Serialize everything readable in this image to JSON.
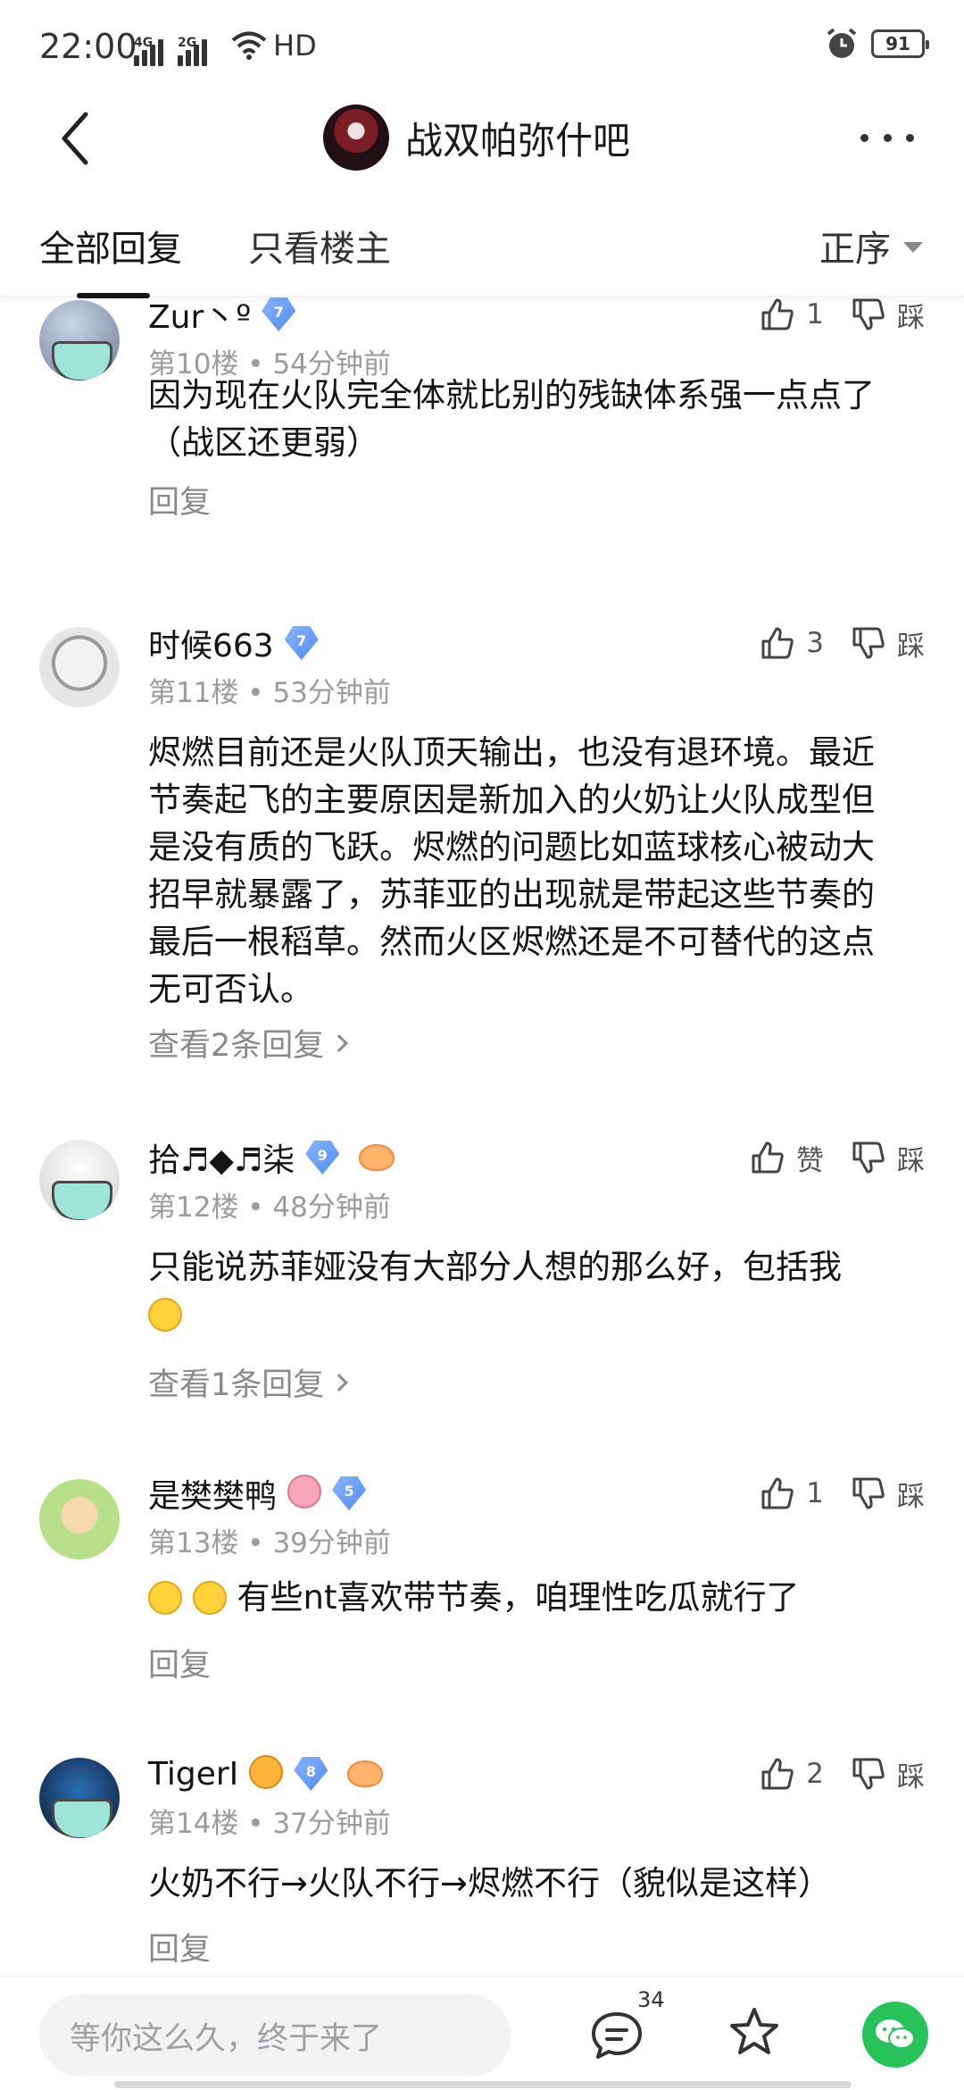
{
  "status_bar": {
    "time": "22:00",
    "network_1": "4G",
    "network_2": "2G",
    "hd_label": "HD",
    "battery": "91"
  },
  "header": {
    "forum_name": "战双帕弥什吧"
  },
  "tabs": {
    "all_replies": "全部回复",
    "owner_only": "只看楼主",
    "sort": "正序"
  },
  "replies": [
    {
      "username": "Zur丶º",
      "level": "7",
      "meta": "第10楼 • 54分钟前",
      "likes": "1",
      "dislike_label": "踩",
      "content": "因为现在火队完全体就比别的残缺体系强一点点了（战区还更弱）",
      "footer": "回复"
    },
    {
      "username": "时候663",
      "level": "7",
      "meta": "第11楼 • 53分钟前",
      "likes": "3",
      "dislike_label": "踩",
      "content": "烬燃目前还是火队顶天输出，也没有退环境。最近节奏起飞的主要原因是新加入的火奶让火队成型但是没有质的飞跃。烬燃的问题比如蓝球核心被动大招早就暴露了，苏菲亚的出现就是带起这些节奏的最后一根稻草。然而火区烬燃还是不可替代的这点无可否认。",
      "footer": "查看2条回复"
    },
    {
      "username": "拾♬◆♬柒",
      "level": "9",
      "meta": "第12楼 • 48分钟前",
      "likes": "赞",
      "dislike_label": "踩",
      "content": "只能说苏菲娅没有大部分人想的那么好，包括我",
      "footer": "查看1条回复"
    },
    {
      "username": "是樊樊鸭",
      "level": "5",
      "meta": "第13楼 • 39分钟前",
      "likes": "1",
      "dislike_label": "踩",
      "content": "有些nt喜欢带节奏，咱理性吃瓜就行了",
      "footer": "回复"
    },
    {
      "username": "TigerI",
      "level": "8",
      "meta": "第14楼 • 37分钟前",
      "likes": "2",
      "dislike_label": "踩",
      "content": "火奶不行→火队不行→烬燃不行（貌似是这样）",
      "footer": "回复"
    }
  ],
  "bottom_bar": {
    "input_placeholder": "等你这么久，终于来了",
    "comment_count": "34"
  },
  "colors": {
    "level_badge": "#4f8cf0",
    "wechat_green": "#27c25a",
    "meta_gray": "#9b9b9b"
  }
}
